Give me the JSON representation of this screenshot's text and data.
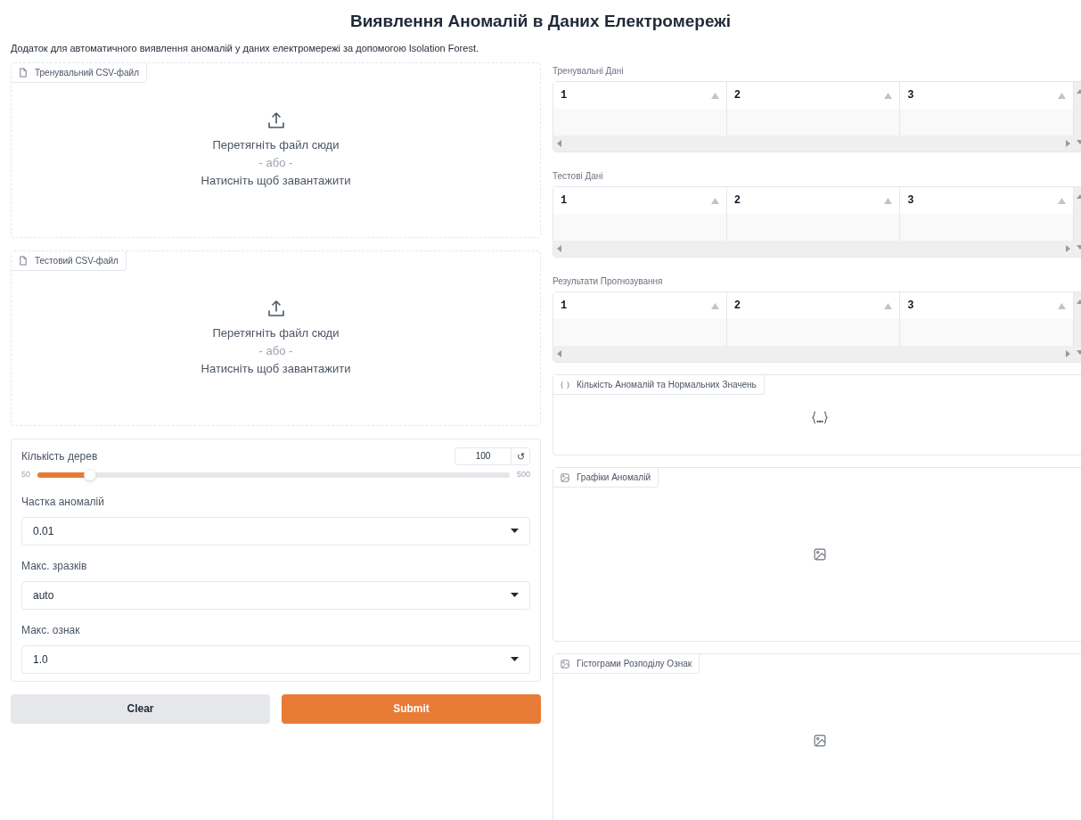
{
  "title": "Виявлення Аномалій в Даних Електромережі",
  "description": "Додаток для автоматичного виявлення аномалій у даних електромережі за допомогою Isolation Forest.",
  "uploads": [
    {
      "label": "Тренувальний CSV-файл",
      "drop_text": "Перетягніть файл сюди",
      "or_text": "- або -",
      "click_text": "Натисніть щоб завантажити"
    },
    {
      "label": "Тестовий CSV-файл",
      "drop_text": "Перетягніть файл сюди",
      "or_text": "- або -",
      "click_text": "Натисніть щоб завантажити"
    }
  ],
  "settings": {
    "slider": {
      "label": "Кількість дерев",
      "value": "100",
      "reset": "↺",
      "min": "50",
      "max": "500",
      "level": 0.111
    },
    "dropdowns": [
      {
        "label": "Частка аномалій",
        "value": "0.01"
      },
      {
        "label": "Макс. зразків",
        "value": "auto"
      },
      {
        "label": "Макс. ознак",
        "value": "1.0"
      }
    ]
  },
  "buttons": [
    {
      "label": "Clear",
      "kind": "secondary"
    },
    {
      "label": "Submit",
      "kind": "primary"
    }
  ],
  "tables": [
    {
      "label": "Тренувальні Дані",
      "columns": [
        "1",
        "2",
        "3"
      ]
    },
    {
      "label": "Тестові Дані",
      "columns": [
        "1",
        "2",
        "3"
      ]
    },
    {
      "label": "Результати Прогнозування",
      "columns": [
        "1",
        "2",
        "3"
      ]
    }
  ],
  "json_output": {
    "label": "Кількість Аномалій та Нормальних Значень"
  },
  "plots": [
    {
      "label": "Графіки Аномалій"
    },
    {
      "label": "Гістограми Розподілу Ознак"
    }
  ]
}
